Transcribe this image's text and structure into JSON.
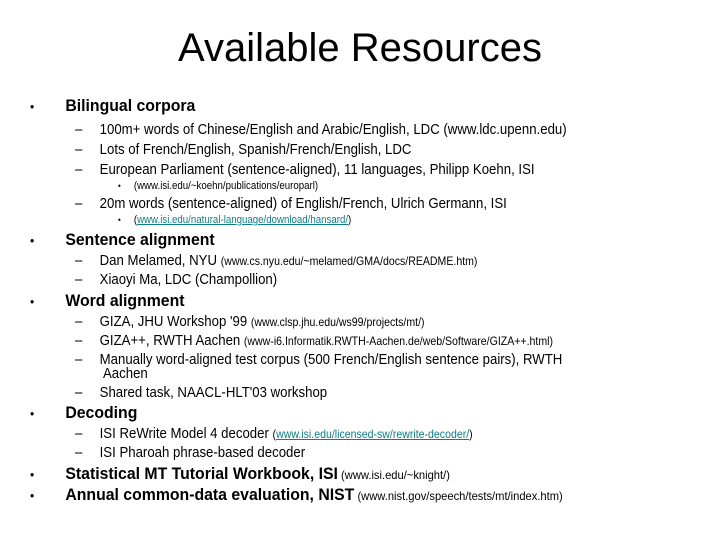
{
  "title": "Available Resources",
  "bullet_glyph": "•",
  "dash_glyph": "–",
  "sections": {
    "bilingual": {
      "label": "Bilingual corpora",
      "items": [
        {
          "text": "100m+ words of Chinese/English and Arabic/English, LDC (www.ldc.upenn.edu)"
        },
        {
          "text": "Lots of French/English, Spanish/French/English, LDC"
        },
        {
          "text": "European Parliament (sentence-aligned), 11 languages, Philipp Koehn, ISI",
          "sub": "(www.isi.edu/~koehn/publications/europarl)"
        },
        {
          "text": "20m words (sentence-aligned) of English/French, Ulrich Germann, ISI",
          "sub_open": "(",
          "sub_link": "www.isi.edu/natural-language/download/hansard/",
          "sub_close": ")"
        }
      ]
    },
    "sentence": {
      "label": "Sentence alignment",
      "items": [
        {
          "text": "Dan Melamed, NYU ",
          "small": "(www.cs.nyu.edu/~melamed/GMA/docs/README.htm)"
        },
        {
          "text": "Xiaoyi Ma, LDC (Champollion)"
        }
      ]
    },
    "word": {
      "label": "Word alignment",
      "items": [
        {
          "text": "GIZA, JHU Workshop '99 ",
          "small": "(www.clsp.jhu.edu/ws99/projects/mt/)"
        },
        {
          "text": "GIZA++, RWTH Aachen ",
          "small": "(www-i6.Informatik.RWTH-Aachen.de/web/Software/GIZA++.html)"
        },
        {
          "text": "Manually word-aligned test corpus (500 French/English sentence pairs), RWTH",
          "cont": "Aachen"
        },
        {
          "text": "Shared task, NAACL-HLT'03 workshop"
        }
      ]
    },
    "decoding": {
      "label": "Decoding",
      "items": [
        {
          "text": "ISI ReWrite Model 4 decoder ",
          "small_open": "(",
          "small_link": "www.isi.edu/licensed-sw/rewrite-decoder/",
          "small_close": ")"
        },
        {
          "text": "ISI Pharoah phrase-based decoder"
        }
      ]
    },
    "workbook": {
      "label": "Statistical MT Tutorial Workbook, ISI",
      "small": " (www.isi.edu/~knight/)"
    },
    "nist": {
      "label": "Annual common-data evaluation, NIST",
      "small": " (www.nist.gov/speech/tests/mt/index.htm)"
    }
  },
  "colors": {
    "link": "#0e7d86",
    "text": "#000000",
    "background": "#ffffff"
  }
}
